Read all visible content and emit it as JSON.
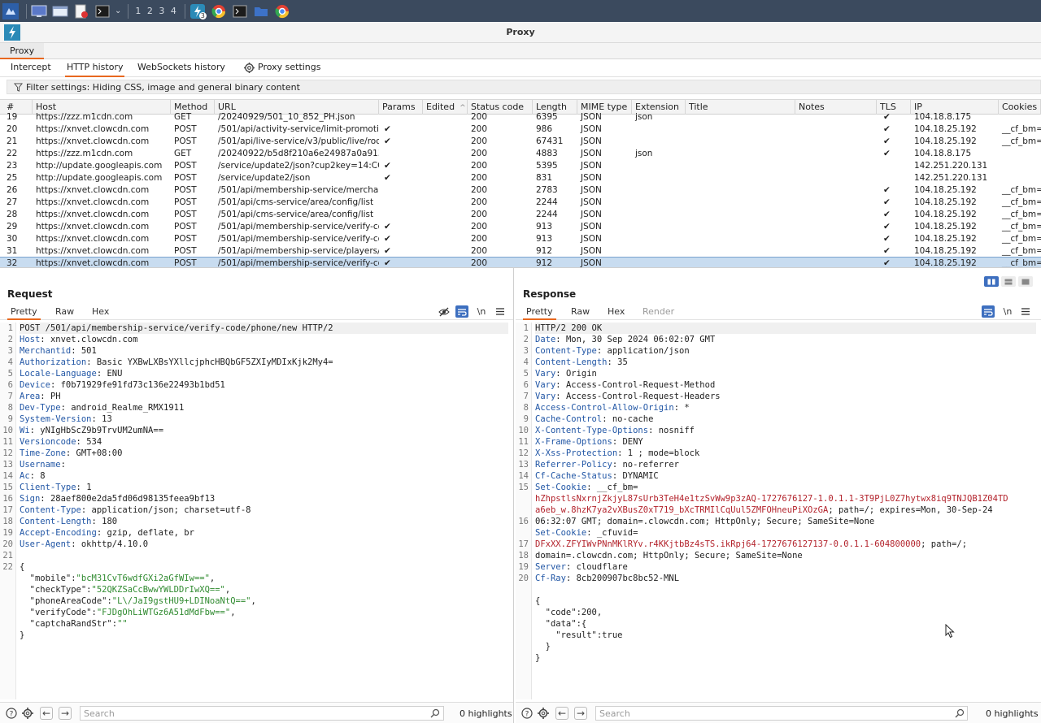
{
  "taskbar": {
    "workspaces": "1 2 3 4",
    "badge": "3"
  },
  "window": {
    "title": "Proxy"
  },
  "main_tab": "Proxy",
  "subtabs": [
    "Intercept",
    "HTTP history",
    "WebSockets history",
    "Proxy settings"
  ],
  "filter": "Filter settings: Hiding CSS, image and general binary content",
  "history": {
    "columns": [
      "#",
      "Host",
      "Method",
      "URL",
      "Params",
      "Edited",
      "Status code",
      "Length",
      "MIME type",
      "Extension",
      "Title",
      "Notes",
      "TLS",
      "IP",
      "Cookies"
    ],
    "sort_indicator": "^",
    "check": "✔",
    "rows": [
      {
        "n": "19",
        "host": "https://zzz.m1cdn.com",
        "method": "GET",
        "url": "/20240929/501_10_852_PH.json",
        "params": "",
        "status": "200",
        "length": "6395",
        "mime": "JSON",
        "ext": "json",
        "tls": "✔",
        "ip": "104.18.8.175",
        "cookies": ""
      },
      {
        "n": "20",
        "host": "https://xnvet.clowcdn.com",
        "method": "POST",
        "url": "/501/api/activity-service/limit-promotio...",
        "params": "✔",
        "status": "200",
        "length": "986",
        "mime": "JSON",
        "ext": "",
        "tls": "✔",
        "ip": "104.18.25.192",
        "cookies": "__cf_bm="
      },
      {
        "n": "21",
        "host": "https://xnvet.clowcdn.com",
        "method": "POST",
        "url": "/501/api/live-service/v3/public/live/roo...",
        "params": "✔",
        "status": "200",
        "length": "67431",
        "mime": "JSON",
        "ext": "",
        "tls": "✔",
        "ip": "104.18.25.192",
        "cookies": "__cf_bm="
      },
      {
        "n": "22",
        "host": "https://zzz.m1cdn.com",
        "method": "GET",
        "url": "/20240922/b5d8f210a6e24987a0a913...",
        "params": "",
        "status": "200",
        "length": "4883",
        "mime": "JSON",
        "ext": "json",
        "tls": "✔",
        "ip": "104.18.8.175",
        "cookies": ""
      },
      {
        "n": "23",
        "host": "http://update.googleapis.com",
        "method": "POST",
        "url": "/service/update2/json?cup2key=14:CQ8...",
        "params": "✔",
        "status": "200",
        "length": "5395",
        "mime": "JSON",
        "ext": "",
        "tls": "",
        "ip": "142.251.220.131",
        "cookies": ""
      },
      {
        "n": "25",
        "host": "http://update.googleapis.com",
        "method": "POST",
        "url": "/service/update2/json",
        "params": "✔",
        "status": "200",
        "length": "831",
        "mime": "JSON",
        "ext": "",
        "tls": "",
        "ip": "142.251.220.131",
        "cookies": ""
      },
      {
        "n": "26",
        "host": "https://xnvet.clowcdn.com",
        "method": "POST",
        "url": "/501/api/membership-service/merchant...",
        "params": "",
        "status": "200",
        "length": "2783",
        "mime": "JSON",
        "ext": "",
        "tls": "✔",
        "ip": "104.18.25.192",
        "cookies": "__cf_bm="
      },
      {
        "n": "27",
        "host": "https://xnvet.clowcdn.com",
        "method": "POST",
        "url": "/501/api/cms-service/area/config/list",
        "params": "",
        "status": "200",
        "length": "2244",
        "mime": "JSON",
        "ext": "",
        "tls": "✔",
        "ip": "104.18.25.192",
        "cookies": "__cf_bm="
      },
      {
        "n": "28",
        "host": "https://xnvet.clowcdn.com",
        "method": "POST",
        "url": "/501/api/cms-service/area/config/list",
        "params": "",
        "status": "200",
        "length": "2244",
        "mime": "JSON",
        "ext": "",
        "tls": "✔",
        "ip": "104.18.25.192",
        "cookies": "__cf_bm="
      },
      {
        "n": "29",
        "host": "https://xnvet.clowcdn.com",
        "method": "POST",
        "url": "/501/api/membership-service/verify-co...",
        "params": "✔",
        "status": "200",
        "length": "913",
        "mime": "JSON",
        "ext": "",
        "tls": "✔",
        "ip": "104.18.25.192",
        "cookies": "__cf_bm="
      },
      {
        "n": "30",
        "host": "https://xnvet.clowcdn.com",
        "method": "POST",
        "url": "/501/api/membership-service/verify-co...",
        "params": "✔",
        "status": "200",
        "length": "913",
        "mime": "JSON",
        "ext": "",
        "tls": "✔",
        "ip": "104.18.25.192",
        "cookies": "__cf_bm="
      },
      {
        "n": "31",
        "host": "https://xnvet.clowcdn.com",
        "method": "POST",
        "url": "/501/api/membership-service/players/a...",
        "params": "✔",
        "status": "200",
        "length": "912",
        "mime": "JSON",
        "ext": "",
        "tls": "✔",
        "ip": "104.18.25.192",
        "cookies": "__cf_bm="
      },
      {
        "n": "32",
        "host": "https://xnvet.clowcdn.com",
        "method": "POST",
        "url": "/501/api/membership-service/verify-co...",
        "params": "✔",
        "status": "200",
        "length": "912",
        "mime": "JSON",
        "ext": "",
        "tls": "✔",
        "ip": "104.18.25.192",
        "cookies": "__cf_bm="
      }
    ]
  },
  "request": {
    "title": "Request",
    "tabs": [
      "Pretty",
      "Raw",
      "Hex"
    ],
    "newline_toggle": "\\n",
    "lines": [
      [
        {
          "t": "POST /501/api/membership-service/verify-code/phone/new HTTP/2"
        }
      ],
      [
        {
          "t": "Host",
          "c": "k"
        },
        {
          "t": ": xnvet.clowcdn.com"
        }
      ],
      [
        {
          "t": "Merchantid",
          "c": "k"
        },
        {
          "t": ": 501"
        }
      ],
      [
        {
          "t": "Authorization",
          "c": "k"
        },
        {
          "t": ": Basic YXBwLXBsYXllcjphcHBQbGF5ZXIyMDIxKjk2My4="
        }
      ],
      [
        {
          "t": "Locale-Language",
          "c": "k"
        },
        {
          "t": ": ENU"
        }
      ],
      [
        {
          "t": "Device",
          "c": "k"
        },
        {
          "t": ": f0b71929fe91fd73c136e22493b1bd51"
        }
      ],
      [
        {
          "t": "Area",
          "c": "k"
        },
        {
          "t": ": PH"
        }
      ],
      [
        {
          "t": "Dev-Type",
          "c": "k"
        },
        {
          "t": ": android_Realme_RMX1911"
        }
      ],
      [
        {
          "t": "System-Version",
          "c": "k"
        },
        {
          "t": ": 13"
        }
      ],
      [
        {
          "t": "Wi",
          "c": "k"
        },
        {
          "t": ": yNIgHbScZ9b9TrvUM2umNA=="
        }
      ],
      [
        {
          "t": "Versioncode",
          "c": "k"
        },
        {
          "t": ": 534"
        }
      ],
      [
        {
          "t": "Time-Zone",
          "c": "k"
        },
        {
          "t": ": GMT+08:00"
        }
      ],
      [
        {
          "t": "Username",
          "c": "k"
        },
        {
          "t": ":"
        }
      ],
      [
        {
          "t": "Ac",
          "c": "k"
        },
        {
          "t": ": 8"
        }
      ],
      [
        {
          "t": "Client-Type",
          "c": "k"
        },
        {
          "t": ": 1"
        }
      ],
      [
        {
          "t": "Sign",
          "c": "k"
        },
        {
          "t": ": 28aef800e2da5fd06d98135feea9bf13"
        }
      ],
      [
        {
          "t": "Content-Type",
          "c": "k"
        },
        {
          "t": ": application/json; charset=utf-8"
        }
      ],
      [
        {
          "t": "Content-Length",
          "c": "k"
        },
        {
          "t": ": 180"
        }
      ],
      [
        {
          "t": "Accept-Encoding",
          "c": "k"
        },
        {
          "t": ": gzip, deflate, br"
        }
      ],
      [
        {
          "t": "User-Agent",
          "c": "k"
        },
        {
          "t": ": okhttp/4.10.0"
        }
      ],
      [],
      [
        {
          "t": "{"
        }
      ],
      [
        {
          "t": "  \"mobile\":"
        },
        {
          "t": "\"bcM31CvT6wdfGXi2aGfWIw==\"",
          "c": "s"
        },
        {
          "t": ","
        }
      ],
      [
        {
          "t": "  \"checkType\":"
        },
        {
          "t": "\"52QKZSaCcBwwYWLDDrIwXQ==\"",
          "c": "s"
        },
        {
          "t": ","
        }
      ],
      [
        {
          "t": "  \"phoneAreaCode\":"
        },
        {
          "t": "\"L\\/JaI9gstHU9+LDINoaNtQ==\"",
          "c": "s"
        },
        {
          "t": ","
        }
      ],
      [
        {
          "t": "  \"verifyCode\":"
        },
        {
          "t": "\"FJDgOhLiWTGz6A51dMdFbw==\"",
          "c": "s"
        },
        {
          "t": ","
        }
      ],
      [
        {
          "t": "  \"captchaRandStr\":"
        },
        {
          "t": "\"\"",
          "c": "s"
        }
      ],
      [
        {
          "t": "}"
        }
      ]
    ],
    "line_numbers": [
      "1",
      "2",
      "3",
      "4",
      "5",
      "6",
      "7",
      "8",
      "9",
      "10",
      "11",
      "12",
      "13",
      "14",
      "15",
      "16",
      "17",
      "18",
      "19",
      "20",
      "21",
      "22"
    ],
    "search_placeholder": "Search",
    "highlights": "0 highlights"
  },
  "response": {
    "title": "Response",
    "tabs": [
      "Pretty",
      "Raw",
      "Hex",
      "Render"
    ],
    "newline_toggle": "\\n",
    "lines": [
      [
        {
          "t": "HTTP/2 200 OK"
        }
      ],
      [
        {
          "t": "Date",
          "c": "k"
        },
        {
          "t": ": Mon, 30 Sep 2024 06:02:07 GMT"
        }
      ],
      [
        {
          "t": "Content-Type",
          "c": "k"
        },
        {
          "t": ": application/json"
        }
      ],
      [
        {
          "t": "Content-Length",
          "c": "k"
        },
        {
          "t": ": 35"
        }
      ],
      [
        {
          "t": "Vary",
          "c": "k"
        },
        {
          "t": ": Origin"
        }
      ],
      [
        {
          "t": "Vary",
          "c": "k"
        },
        {
          "t": ": Access-Control-Request-Method"
        }
      ],
      [
        {
          "t": "Vary",
          "c": "k"
        },
        {
          "t": ": Access-Control-Request-Headers"
        }
      ],
      [
        {
          "t": "Access-Control-Allow-Origin",
          "c": "k"
        },
        {
          "t": ": *"
        }
      ],
      [
        {
          "t": "Cache-Control",
          "c": "k"
        },
        {
          "t": ": no-cache"
        }
      ],
      [
        {
          "t": "X-Content-Type-Options",
          "c": "k"
        },
        {
          "t": ": nosniff"
        }
      ],
      [
        {
          "t": "X-Frame-Options",
          "c": "k"
        },
        {
          "t": ": DENY"
        }
      ],
      [
        {
          "t": "X-Xss-Protection",
          "c": "k"
        },
        {
          "t": ": 1 ; mode=block"
        }
      ],
      [
        {
          "t": "Referrer-Policy",
          "c": "k"
        },
        {
          "t": ": no-referrer"
        }
      ],
      [
        {
          "t": "Cf-Cache-Status",
          "c": "k"
        },
        {
          "t": ": DYNAMIC"
        }
      ],
      [
        {
          "t": "Set-Cookie",
          "c": "k"
        },
        {
          "t": ": __cf_bm="
        }
      ],
      [
        {
          "t": "hZhpstlsNxrnjZkjyL87sUrb3TeH4e1tzSvWw9p3zAQ-1727676127-1.0.1.1-3T9PjL0Z7hytwx8iq9TNJQB1Z04TD",
          "c": "r"
        }
      ],
      [
        {
          "t": "a6eb_w.8hzK7ya2vXBusZ0xT719_bXcTRMIlCqUul5ZMFOHneuPiXOzGA",
          "c": "r"
        },
        {
          "t": "; path=/; expires=Mon, 30-Sep-24"
        }
      ],
      [
        {
          "t": "06:32:07 GMT; domain=.clowcdn.com; HttpOnly; Secure; SameSite=None"
        }
      ],
      [
        {
          "t": "Set-Cookie",
          "c": "k"
        },
        {
          "t": ": _cfuvid="
        }
      ],
      [
        {
          "t": "DFxXX.ZFYIWvPNnMKlRYv.r4KKjtbBz4sTS.ikRpj64-1727676127137-0.0.1.1-604800000",
          "c": "r"
        },
        {
          "t": "; path=/;"
        }
      ],
      [
        {
          "t": "domain=.clowcdn.com; HttpOnly; Secure; SameSite=None"
        }
      ],
      [
        {
          "t": "Server",
          "c": "k"
        },
        {
          "t": ": cloudflare"
        }
      ],
      [
        {
          "t": "Cf-Ray",
          "c": "k"
        },
        {
          "t": ": 8cb200907bc8bc52-MNL"
        }
      ],
      [],
      [
        {
          "t": "{"
        }
      ],
      [
        {
          "t": "  \"code\":200,"
        }
      ],
      [
        {
          "t": "  \"data\":{"
        }
      ],
      [
        {
          "t": "    \"result\":true"
        }
      ],
      [
        {
          "t": "  }"
        }
      ],
      [
        {
          "t": "}"
        }
      ]
    ],
    "line_numbers": [
      "1",
      "2",
      "3",
      "4",
      "5",
      "6",
      "7",
      "8",
      "9",
      "10",
      "11",
      "12",
      "13",
      "14",
      "15",
      "",
      "",
      "16",
      "",
      "17",
      "18",
      "19",
      "20"
    ],
    "search_placeholder": "Search",
    "highlights": "0 highlights"
  }
}
